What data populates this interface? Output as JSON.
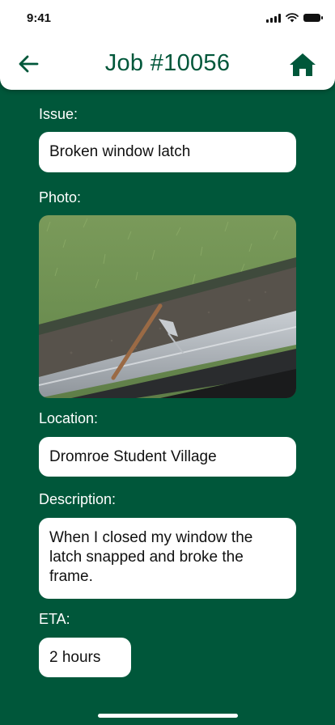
{
  "status_bar": {
    "time": "9:41"
  },
  "header": {
    "title": "Job #10056",
    "back_icon": "arrow-left-icon",
    "home_icon": "home-icon"
  },
  "issue": {
    "label": "Issue:",
    "value": "Broken window latch"
  },
  "photo": {
    "label": "Photo:"
  },
  "location": {
    "label": "Location:",
    "value": "Dromroe Student Village"
  },
  "description": {
    "label": "Description:",
    "value": "When I closed my window the latch snapped and broke the frame."
  },
  "eta": {
    "label": "ETA:",
    "value": "2 hours"
  },
  "colors": {
    "brand_green": "#00573a",
    "card_white": "#ffffff"
  }
}
